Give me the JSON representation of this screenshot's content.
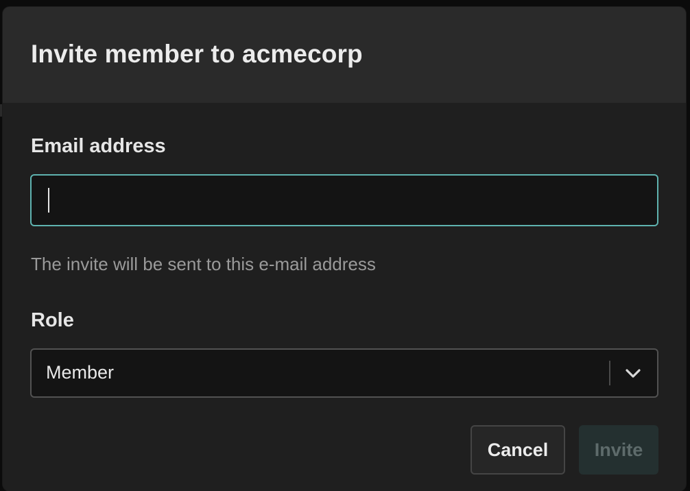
{
  "modal": {
    "title": "Invite member to acmecorp",
    "email": {
      "label": "Email address",
      "value": "",
      "hint": "The invite will be sent to this e-mail address"
    },
    "role": {
      "label": "Role",
      "selected": "Member",
      "chevron_icon": "chevron-down-icon"
    },
    "buttons": {
      "cancel_label": "Cancel",
      "invite_label": "Invite",
      "invite_disabled": true
    }
  },
  "colors": {
    "focus_border": "#5fb3b0",
    "invite_disabled_bg": "#243030",
    "invite_disabled_text": "#5e6b6b"
  }
}
